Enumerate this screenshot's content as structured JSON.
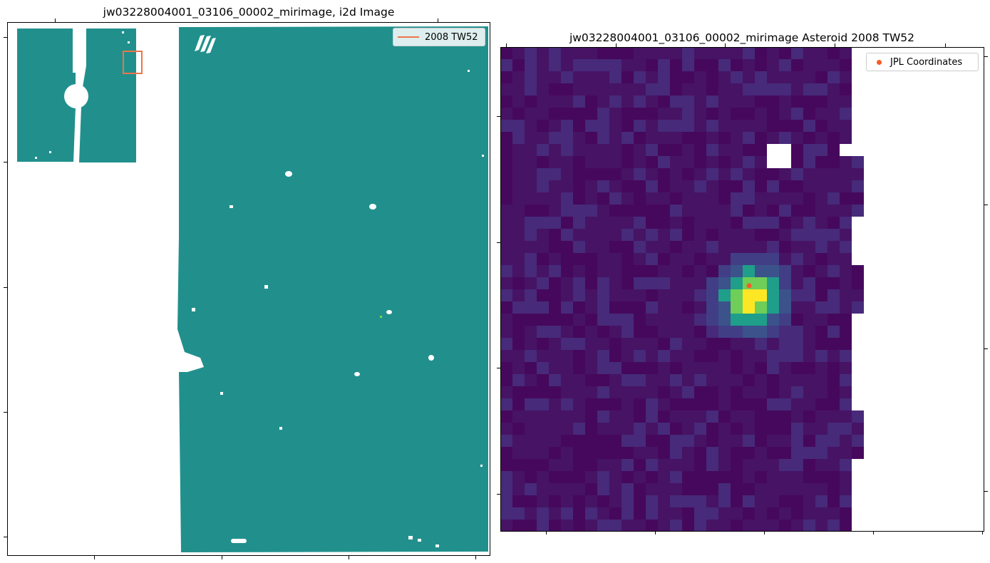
{
  "left_panel": {
    "title": "jw03228004001_03106_00002_mirimage,  i2d Image",
    "legend_label": "2008 TW52",
    "legend_color": "#ee7449",
    "fill_color": "#21908d"
  },
  "right_panel": {
    "title": "jw03228004001_03106_00002_mirimage Asteroid 2008 TW52",
    "legend_label": "JPL Coordinates",
    "marker_color": "#f75a2a",
    "colormap": "viridis"
  }
}
